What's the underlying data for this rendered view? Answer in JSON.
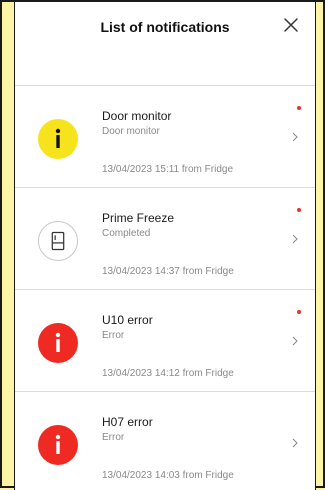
{
  "header": {
    "title": "List of notifications"
  },
  "colors": {
    "background": "#fdf4a6",
    "info_yellow": "#f7e31b",
    "error_red": "#ef2a23",
    "unread_dot": "#e8322a"
  },
  "notifications": [
    {
      "title": "Door monitor",
      "subtitle": "Door monitor",
      "meta": "13/04/2023 15:11 from Fridge",
      "icon": "info-icon",
      "unread": true
    },
    {
      "title": "Prime Freeze",
      "subtitle": "Completed",
      "meta": "13/04/2023 14:37 from Fridge",
      "icon": "fridge-icon",
      "unread": true
    },
    {
      "title": "U10 error",
      "subtitle": "Error",
      "meta": "13/04/2023 14:12 from Fridge",
      "icon": "error-icon",
      "unread": true
    },
    {
      "title": "H07 error",
      "subtitle": "Error",
      "meta": "13/04/2023 14:03 from Fridge",
      "icon": "error-icon",
      "unread": false
    }
  ]
}
